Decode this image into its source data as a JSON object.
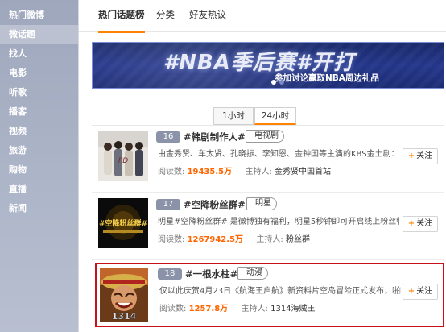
{
  "sidebar": {
    "items": [
      {
        "label": "热门微博"
      },
      {
        "label": "微话题"
      },
      {
        "label": "找人"
      },
      {
        "label": "电影"
      },
      {
        "label": "听歌"
      },
      {
        "label": "播客"
      },
      {
        "label": "视频"
      },
      {
        "label": "旅游"
      },
      {
        "label": "购物"
      },
      {
        "label": "直播"
      },
      {
        "label": "新闻"
      }
    ],
    "active_index": 1
  },
  "tabs": [
    {
      "label": "热门话题榜"
    },
    {
      "label": "分类"
    },
    {
      "label": "好友热议"
    }
  ],
  "banner": {
    "title": "#NBA季后赛#开打",
    "subtitle": "参加讨论赢取NBA周边礼品"
  },
  "time_toggle": [
    {
      "label": "1小时"
    },
    {
      "label": "24小时"
    }
  ],
  "topics": [
    {
      "rank": "16",
      "title": "#韩剧制作人#",
      "category": "电视剧",
      "desc": "由金秀贤、车太贤、孔晓振、李知恩、金钟国等主演的KBS金土剧：《制作...",
      "read_label": "阅读数:",
      "reads": "19435.5万",
      "host_label": "主持人:",
      "host": "金秀贤中国首站",
      "follow_label": "关注"
    },
    {
      "rank": "17",
      "title": "#空降粉丝群#",
      "category": "明星",
      "desc": "明星#空降粉丝群# 是微博独有福利，明星5秒钟即可开启线上粉丝畅谈会...",
      "read_label": "阅读数:",
      "reads": "1267942.5万",
      "host_label": "主持人:",
      "host": "粉丝群",
      "thumb_text": "#空降粉丝群#",
      "follow_label": "关注"
    },
    {
      "rank": "18",
      "title": "#一根水柱#",
      "category": "动漫",
      "desc": "仅以此庆贺4月23日《航海王启航》新资料片空岛冒险正式发布，啪啪啪~~~",
      "read_label": "阅读数:",
      "reads": "1257.8万",
      "host_label": "主持人:",
      "host": "1314海贼王",
      "thumb_text": "1314",
      "follow_label": "关注"
    }
  ],
  "colors": {
    "accent": "#ff8200",
    "highlight_border": "#c8101b",
    "rank_badge": "#8a93a8"
  }
}
